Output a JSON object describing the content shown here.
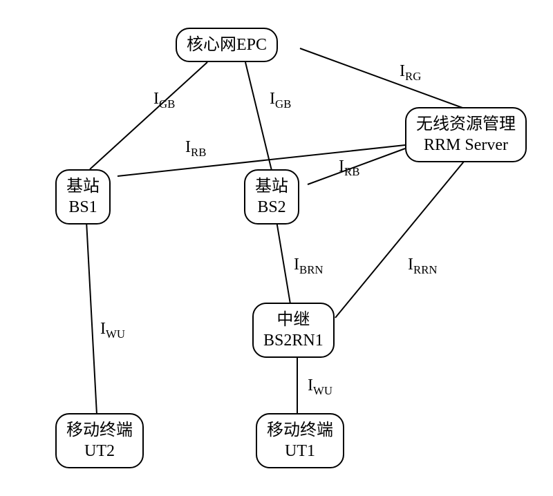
{
  "nodes": {
    "epc": {
      "line1": "核心网EPC"
    },
    "rrm": {
      "line1": "无线资源管理",
      "line2": "RRM Server"
    },
    "bs1": {
      "line1": "基站",
      "line2": "BS1"
    },
    "bs2": {
      "line1": "基站",
      "line2": "BS2"
    },
    "relay": {
      "line1": "中继",
      "line2": "BS2RN1"
    },
    "ut1": {
      "line1": "移动终端",
      "line2": "UT1"
    },
    "ut2": {
      "line1": "移动终端",
      "line2": "UT2"
    }
  },
  "edge_labels": {
    "rg": {
      "main": "I",
      "sub": "RG"
    },
    "gb1": {
      "main": "I",
      "sub": "GB"
    },
    "gb2": {
      "main": "I",
      "sub": "GB"
    },
    "rb1": {
      "main": "I",
      "sub": "RB"
    },
    "rb2": {
      "main": "I",
      "sub": "RB"
    },
    "rrn": {
      "main": "I",
      "sub": "RRN"
    },
    "brn": {
      "main": "I",
      "sub": "BRN"
    },
    "wu1": {
      "main": "I",
      "sub": "WU"
    },
    "wu2": {
      "main": "I",
      "sub": "WU"
    }
  },
  "chart_data": {
    "type": "diagram",
    "title": "",
    "nodes": [
      {
        "id": "EPC",
        "label": "核心网EPC"
      },
      {
        "id": "RRM",
        "label": "无线资源管理 RRM Server"
      },
      {
        "id": "BS1",
        "label": "基站 BS1"
      },
      {
        "id": "BS2",
        "label": "基站 BS2"
      },
      {
        "id": "BS2RN1",
        "label": "中继 BS2RN1"
      },
      {
        "id": "UT1",
        "label": "移动终端 UT1"
      },
      {
        "id": "UT2",
        "label": "移动终端 UT2"
      }
    ],
    "edges": [
      {
        "from": "EPC",
        "to": "RRM",
        "label": "I_RG"
      },
      {
        "from": "EPC",
        "to": "BS1",
        "label": "I_GB"
      },
      {
        "from": "EPC",
        "to": "BS2",
        "label": "I_GB"
      },
      {
        "from": "RRM",
        "to": "BS1",
        "label": "I_RB"
      },
      {
        "from": "RRM",
        "to": "BS2",
        "label": "I_RB"
      },
      {
        "from": "RRM",
        "to": "BS2RN1",
        "label": "I_RRN"
      },
      {
        "from": "BS2",
        "to": "BS2RN1",
        "label": "I_BRN"
      },
      {
        "from": "BS1",
        "to": "UT2",
        "label": "I_WU"
      },
      {
        "from": "BS2RN1",
        "to": "UT1",
        "label": "I_WU"
      }
    ]
  }
}
